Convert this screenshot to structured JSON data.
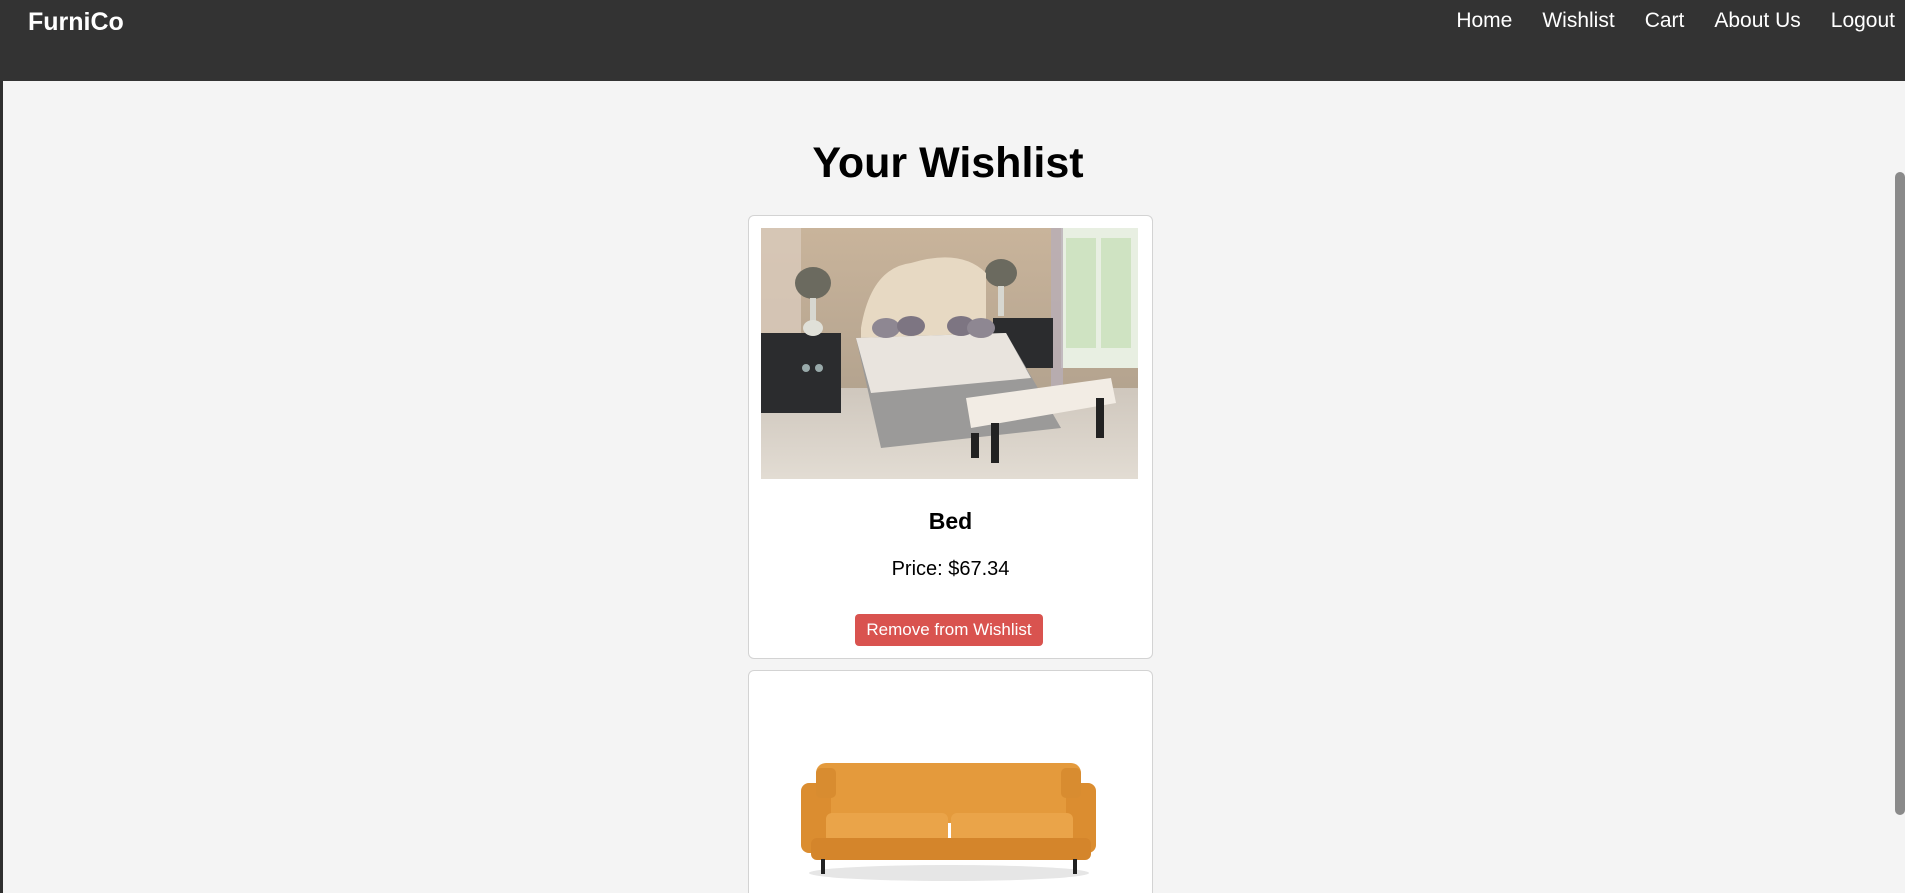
{
  "header": {
    "brand": "FurniCo",
    "nav": [
      "Home",
      "Wishlist",
      "Cart",
      "About Us",
      "Logout"
    ]
  },
  "main": {
    "title": "Your Wishlist",
    "items": [
      {
        "name": "Bed",
        "price": "Price: $67.34",
        "button": "Remove from Wishlist",
        "image": "bed-photo"
      },
      {
        "name": "",
        "image": "orange-sofa-photo"
      }
    ]
  },
  "colors": {
    "header_bg": "#333333",
    "page_bg": "#f4f4f4",
    "remove_button": "#d9534f"
  }
}
